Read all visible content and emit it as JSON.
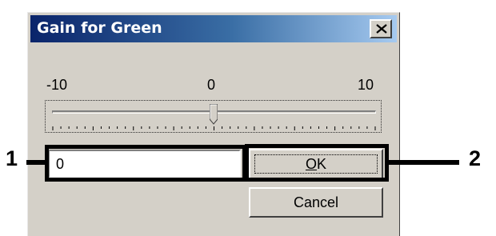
{
  "dialog": {
    "title": "Gain for Green",
    "close_glyph": "×"
  },
  "slider": {
    "min_label": "-10",
    "mid_label": "0",
    "max_label": "10",
    "min": -10,
    "max": 10,
    "value": 0,
    "tick_count": 41
  },
  "input": {
    "value": "0"
  },
  "buttons": {
    "ok_mnemonic": "O",
    "ok_rest": "K",
    "cancel_label": "Cancel"
  },
  "callouts": {
    "left_number": "1",
    "right_number": "2"
  },
  "colors": {
    "title_start": "#0a246a",
    "title_end": "#a6caf0",
    "face": "#d4d0c8"
  },
  "icons": {
    "close": "close-icon",
    "slider_thumb": "slider-thumb-icon"
  }
}
